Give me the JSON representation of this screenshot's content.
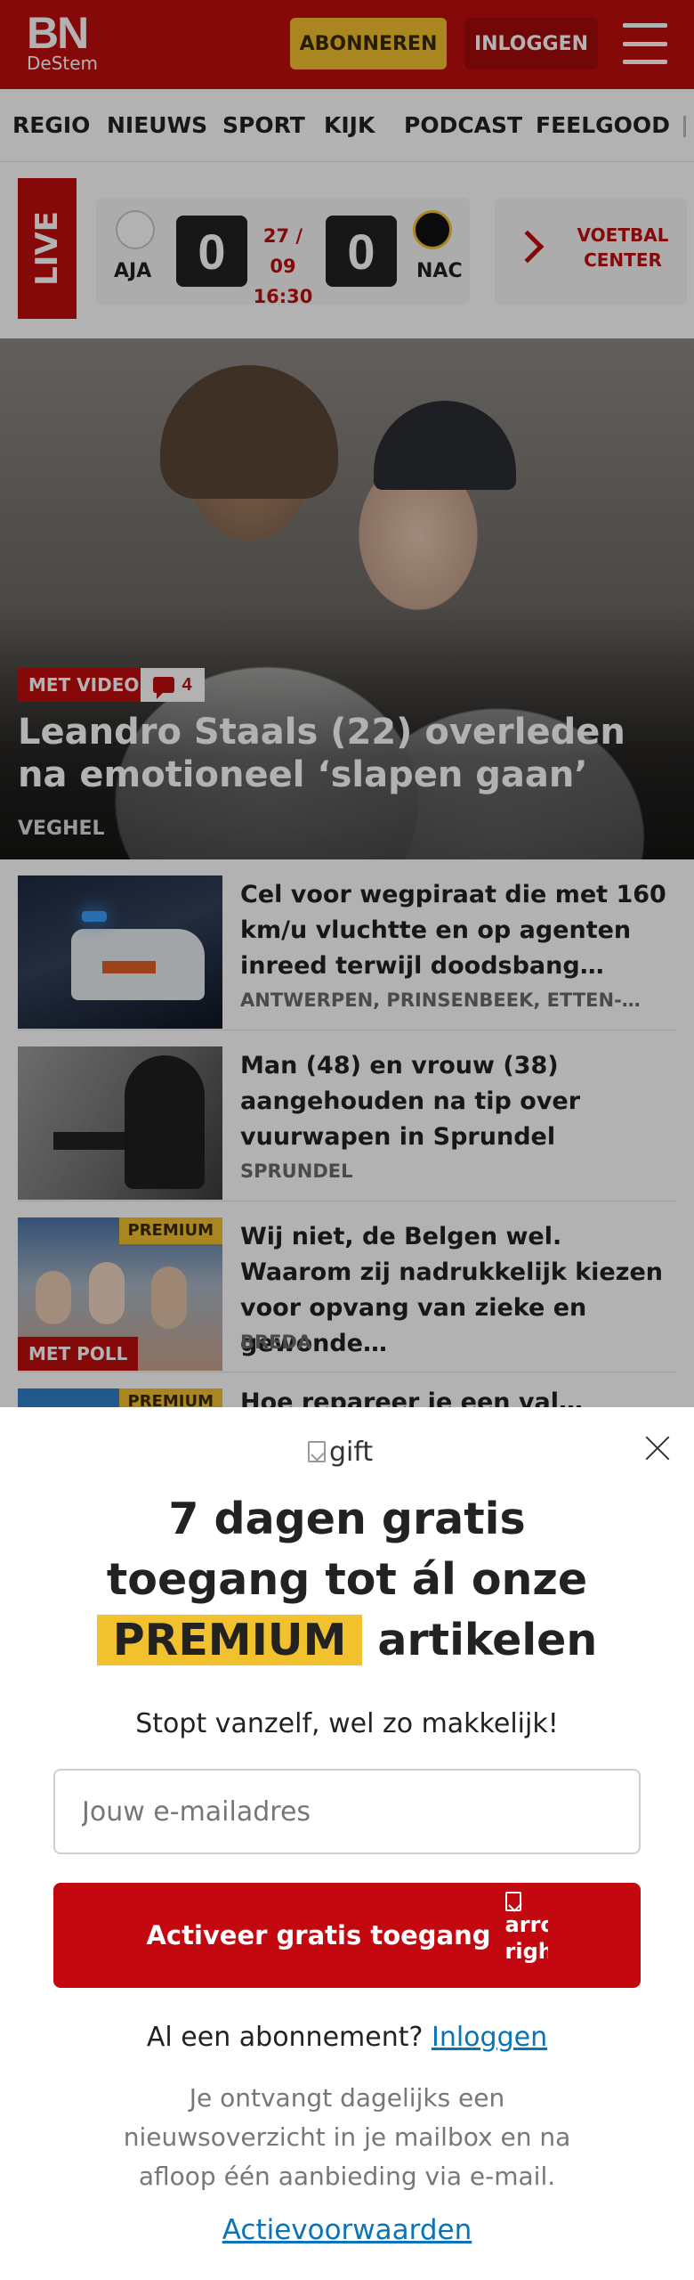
{
  "header": {
    "logo_main": "BN",
    "logo_sub": "DeStem",
    "subscribe_label": "ABONNEREN",
    "login_label": "INLOGGEN",
    "colors": {
      "brand": "#c00d0d",
      "accent": "#f2c12e"
    }
  },
  "nav": {
    "items": [
      {
        "label": "REGIO"
      },
      {
        "label": "NIEUWS"
      },
      {
        "label": "SPORT"
      },
      {
        "label": "KIJK"
      },
      {
        "label": "PODCAST"
      },
      {
        "label": "FEELGOOD"
      }
    ]
  },
  "score": {
    "live_label": "LIVE",
    "home_team": "AJA",
    "away_team": "NAC",
    "home_score": "0",
    "away_score": "0",
    "date": "27 / 09",
    "time": "16:30",
    "center_label_line1": "VOETBAL",
    "center_label_line2": "CENTER"
  },
  "hero": {
    "badge_video": "MET VIDEO",
    "comment_count": "4",
    "title": "Leandro Staals (22) overleden na emotioneel ‘slapen gaan’",
    "location": "VEGHEL"
  },
  "articles": [
    {
      "title": "Cel voor wegpiraat die met 160 km/u vluchtte en op agenten inreed terwijl doodsbang…",
      "location": "ANTWERPEN, PRINSENBEEK, ETTEN-…"
    },
    {
      "title": "Man (48) en vrouw (38) aangehou­den na tip over vuurwapen in Sprundel",
      "location": "SPRUNDEL"
    },
    {
      "title": "Wij niet, de Belgen wel. Waarom zij nadrukkelijk kiezen voor opvang van zieke en gewonde…",
      "location": "BREDA",
      "premium_tag": "PREMIUM",
      "poll_tag": "MET POLL"
    },
    {
      "title": "Hoe repareer je een val…",
      "premium_tag": "PREMIUM"
    }
  ],
  "modal": {
    "gift_alt": "gift",
    "title_line1": "7 dagen gratis",
    "title_line2": "toegang tot ál onze",
    "title_highlight": "PREMIUM",
    "title_end": "artikelen",
    "subtitle": "Stopt vanzelf, wel zo makkelijk!",
    "email_placeholder": "Jouw e-mailadres",
    "cta_label": "Activeer gratis toegang",
    "arrow_alt": "arrow right",
    "login_prompt": "Al een abonnement?",
    "login_link": "Inloggen",
    "info_text": "Je ontvangt dagelijks een nieuwsoverzicht in je mailbox en na afloop één aanbieding via e-mail.",
    "terms_link": "Actievoorwaarden"
  }
}
